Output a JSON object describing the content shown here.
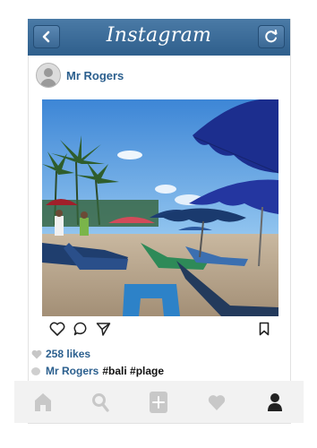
{
  "app": {
    "title": "Instagram"
  },
  "post": {
    "username": "Mr Rogers",
    "likes": "258 likes",
    "caption_user": "Mr Rogers",
    "caption_text": "#bali #plage"
  },
  "icons": {
    "back": "chevron-left-icon",
    "refresh": "refresh-icon",
    "like": "heart-outline-icon",
    "comment": "comment-icon",
    "share": "send-icon",
    "save": "bookmark-icon",
    "tabs": [
      "home-icon",
      "search-icon",
      "add-icon",
      "heart-icon",
      "profile-icon"
    ]
  },
  "colors": {
    "accent": "#2b5f8e",
    "topbar": "#3a6894",
    "tab_inactive": "#c8c8c8",
    "tab_active": "#222222"
  }
}
